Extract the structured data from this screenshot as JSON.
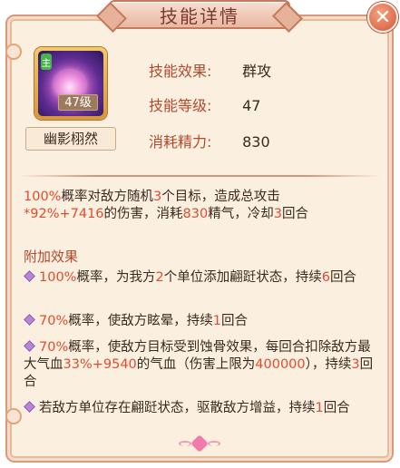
{
  "window": {
    "title": "技能详情",
    "close_symbol": "✕"
  },
  "skill": {
    "icon": "lotus-skill-icon",
    "badge": "主",
    "level_badge": "47级",
    "name": "幽影栩然"
  },
  "stats": [
    {
      "label": "技能效果:",
      "value": "群攻"
    },
    {
      "label": "技能等级:",
      "value": "47"
    },
    {
      "label": "消耗精力:",
      "value": "830"
    }
  ],
  "description": {
    "p1": [
      "100%",
      "概率对敌方随机",
      "3",
      "个目标，造成总攻击",
      "*92%+7416",
      "的伤害，消耗",
      "830",
      "精气，冷却",
      "3",
      "回合"
    ],
    "extra_title": "附加效果",
    "e1": [
      "100%",
      "概率，为我方",
      "2",
      "个单位添加翩跹状态，持续",
      "6",
      "回合"
    ],
    "e2": [
      "70%",
      "概率，使敌方眩晕，持续",
      "1",
      "回合"
    ],
    "e3": [
      "70%",
      "概率，使敌方目标受到蚀骨效果，每回合扣除敌方最大气血",
      "33%+9540",
      "的气血（伤害上限为",
      "400000",
      "），持续",
      "3",
      "回合"
    ],
    "e4": [
      "若敌方单位存在翩跹状态，驱散敌方增益，持续",
      "1",
      "回合"
    ]
  },
  "colors": {
    "accent": "#b14a2d",
    "highlight": "#e04d2e",
    "background": "#fbefe0"
  }
}
